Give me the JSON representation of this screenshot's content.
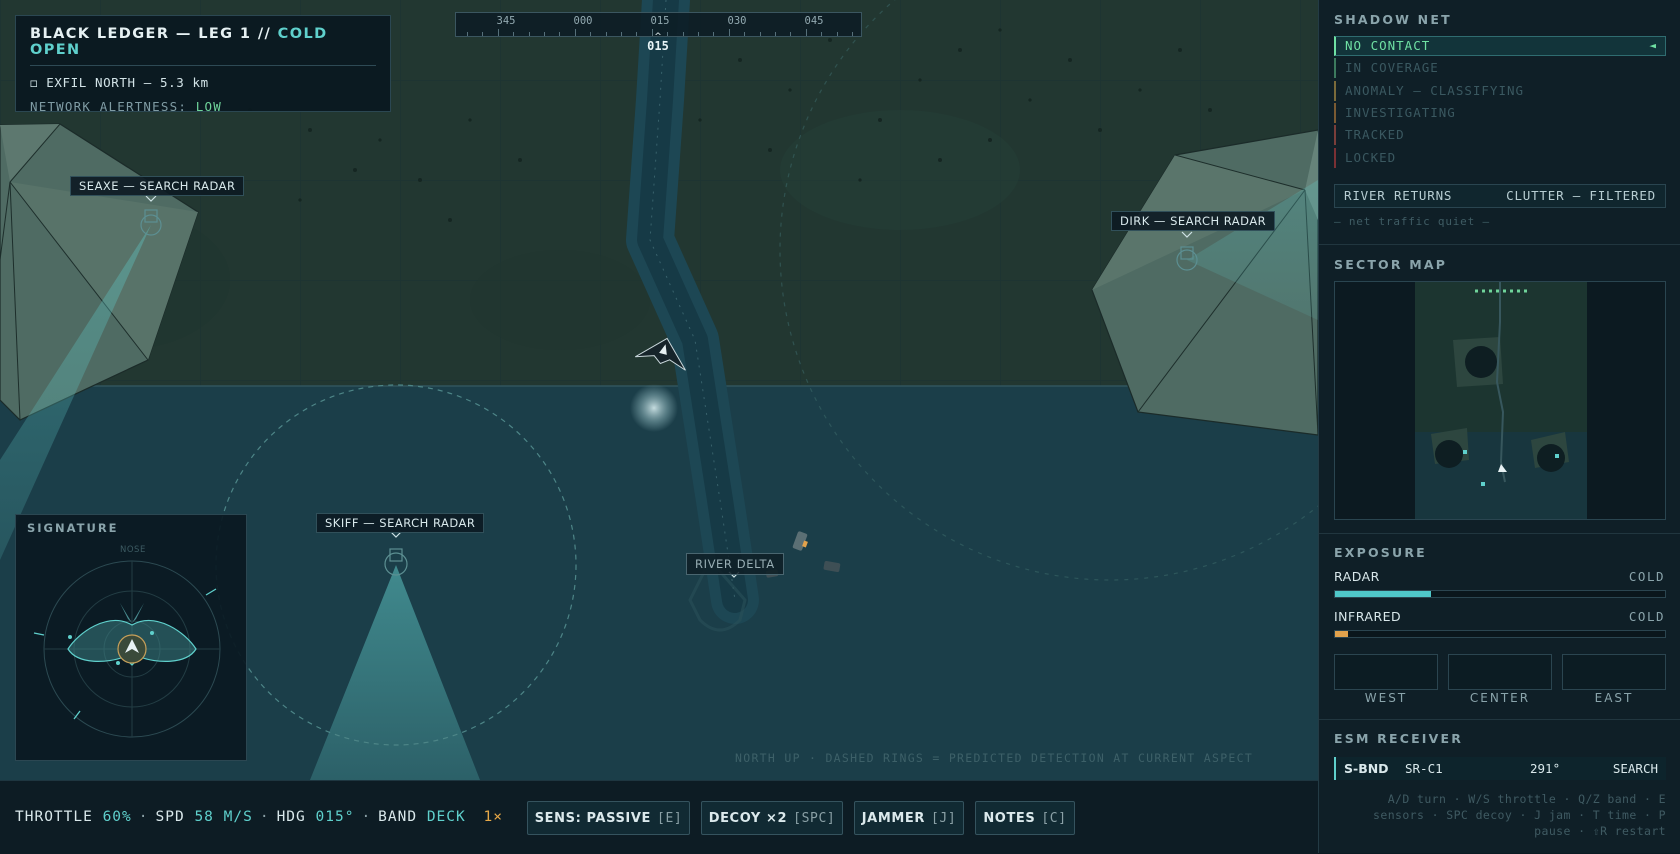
{
  "mission": {
    "title": "BLACK LEDGER — LEG 1 //",
    "phase": "COLD OPEN",
    "objective_icon": "◻",
    "objective": "EXFIL NORTH — 5.3 km",
    "alert_label": "NETWORK ALERTNESS:",
    "alert_value": "LOW"
  },
  "heading_tape": {
    "ticks": [
      "345",
      "000",
      "015",
      "030",
      "045"
    ],
    "caret": "^",
    "readout": "015"
  },
  "radars": {
    "seaxe": "SEAXE — SEARCH RADAR",
    "dirk": "DIRK — SEARCH RADAR",
    "skiff": "SKIFF — SEARCH RADAR"
  },
  "map": {
    "river_delta_label": "RIVER DELTA",
    "footer_note": "NORTH UP · DASHED RINGS = PREDICTED DETECTION AT CURRENT ASPECT"
  },
  "signature": {
    "title": "SIGNATURE",
    "nose_label": "NOSE"
  },
  "status": {
    "throttle_label": "THROTTLE",
    "throttle_value": "60%",
    "speed_label": "SPD",
    "speed_value": "58 M/S",
    "heading_label": "HDG",
    "heading_value": "015°",
    "band_label": "BAND",
    "band_value": "DECK",
    "time_scale": "1×",
    "separator": "·"
  },
  "buttons": {
    "sensors": {
      "label": "SENS: PASSIVE",
      "key": "[E]"
    },
    "decoy": {
      "label": "DECOY ×2",
      "key": "[SPC]"
    },
    "jammer": {
      "label": "JAMMER",
      "key": "[J]"
    },
    "notes": {
      "label": "NOTES",
      "key": "[C]"
    }
  },
  "shadow_net": {
    "title": "SHADOW NET",
    "states": [
      {
        "label": "NO CONTACT",
        "color": "#6fe0a3"
      },
      {
        "label": "IN COVERAGE",
        "color": "#3c7a5e"
      },
      {
        "label": "ANOMALY — CLASSIFYING",
        "color": "#7a6a3a"
      },
      {
        "label": "INVESTIGATING",
        "color": "#7a5a32"
      },
      {
        "label": "TRACKED",
        "color": "#7a3e3a"
      },
      {
        "label": "LOCKED",
        "color": "#7a3034"
      }
    ],
    "active_marker": "◄",
    "river_returns_label": "RIVER RETURNS",
    "river_returns_value": "CLUTTER — FILTERED",
    "traffic_note": "— net traffic quiet —"
  },
  "sector_map": {
    "title": "SECTOR MAP"
  },
  "exposure": {
    "title": "EXPOSURE",
    "radar_label": "RADAR",
    "radar_value": "COLD",
    "radar_level": 0.29,
    "infrared_label": "INFRARED",
    "infrared_value": "COLD",
    "infrared_level": 0.04,
    "zones": [
      "WEST",
      "CENTER",
      "EAST"
    ]
  },
  "esm": {
    "title": "ESM RECEIVER",
    "band": "S-BND",
    "emitter": "SR-C1",
    "bearing": "291°",
    "mode": "SEARCH"
  },
  "help": {
    "line1": "A/D turn · W/S throttle · Q/Z band · E",
    "line2": "sensors · SPC decoy · J jam · T time · P",
    "line3": "pause · ⇧R restart"
  },
  "colors": {
    "accent": "#5fd0cc",
    "ok": "#6fd49a",
    "warn": "#e7a948",
    "radar_fill": "#4fc7c9",
    "infrared_fill": "#e2a24c"
  }
}
